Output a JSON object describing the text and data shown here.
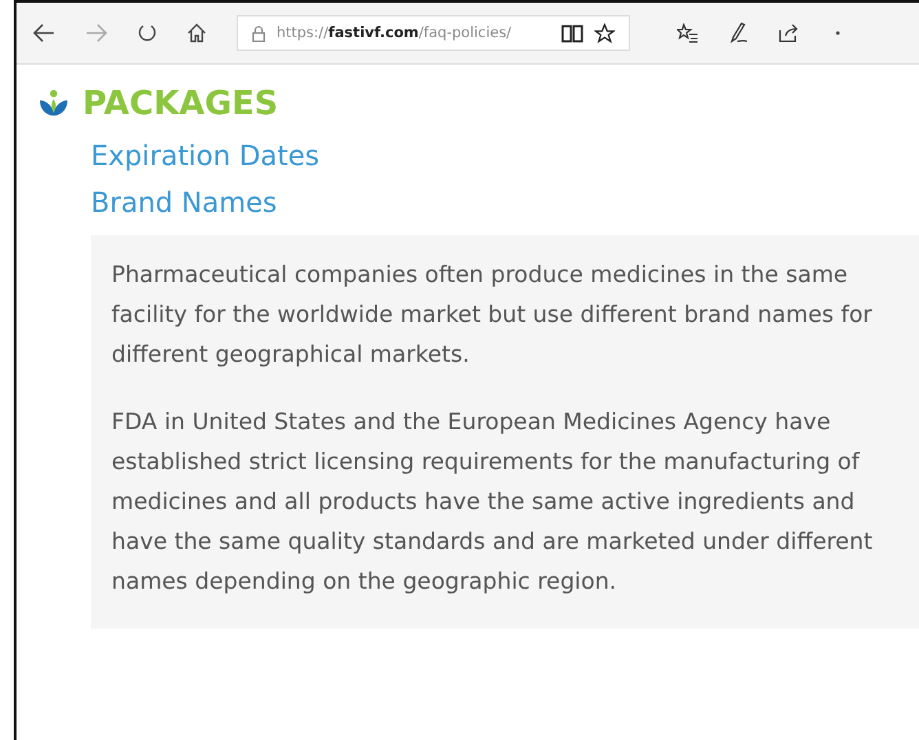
{
  "browser": {
    "url": "https://**fastivf.com**/faq-policies/"
  },
  "heading": "PACKAGES",
  "links": [
    "Expiration Dates",
    "Brand Names"
  ],
  "paragraphs": [
    "Pharmaceutical companies often produce medicines in the same facility for the worldwide market but use different brand names for different geographical markets.",
    "FDA in United States and the European Medicines Agency have established strict licensing requirements for the manufacturing of medicines and all products have the same active ingredients and have the same quality standards and are marketed under different names depending on the geographic region."
  ]
}
